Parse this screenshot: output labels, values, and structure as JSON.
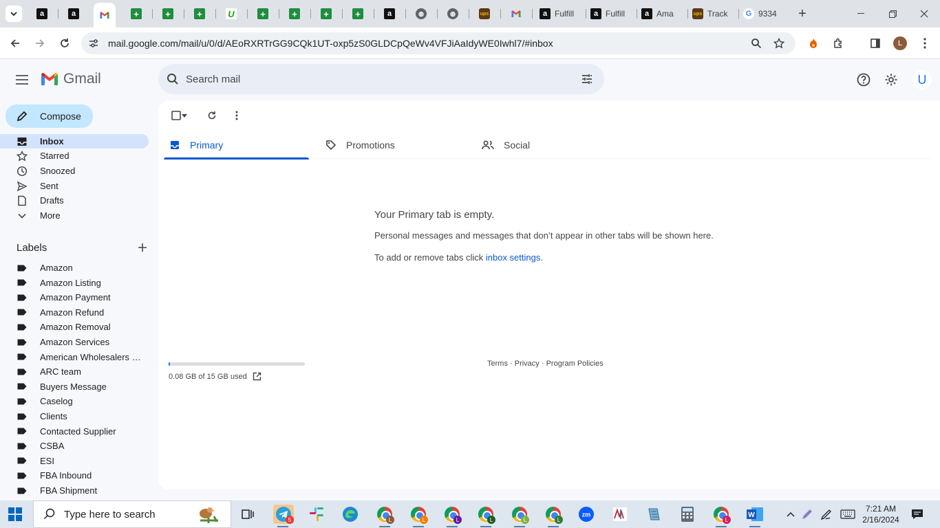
{
  "browser": {
    "tabs": [
      {
        "label": "",
        "favicon": "amazon"
      },
      {
        "label": "",
        "favicon": "amazon"
      },
      {
        "label": "",
        "favicon": "gmail",
        "active": true
      },
      {
        "label": "",
        "favicon": "sheets"
      },
      {
        "label": "",
        "favicon": "sheets"
      },
      {
        "label": "",
        "favicon": "sheets"
      },
      {
        "label": "",
        "favicon": "upwork"
      },
      {
        "label": "",
        "favicon": "sheets"
      },
      {
        "label": "",
        "favicon": "sheets"
      },
      {
        "label": "",
        "favicon": "sheets"
      },
      {
        "label": "",
        "favicon": "sheets"
      },
      {
        "label": "",
        "favicon": "amazon"
      },
      {
        "label": "",
        "favicon": "globe"
      },
      {
        "label": "",
        "favicon": "globe"
      },
      {
        "label": "",
        "favicon": "ups"
      },
      {
        "label": "",
        "favicon": "gmail"
      },
      {
        "label": "Fulfill",
        "favicon": "amazon"
      },
      {
        "label": "Fulfill",
        "favicon": "amazon"
      },
      {
        "label": "Ama",
        "favicon": "amazon"
      },
      {
        "label": "Track",
        "favicon": "ups"
      },
      {
        "label": "9334",
        "favicon": "google"
      }
    ],
    "url": "mail.google.com/mail/u/0/d/AEoRXRTrGG9CQk1UT-oxp5zS0GLDCpQeWv4VFJiAaIdyWE0Iwhl7/#inbox",
    "profile_initial": "L"
  },
  "gmail": {
    "app_name": "Gmail",
    "search_placeholder": "Search mail",
    "account_initial": "U",
    "compose_label": "Compose",
    "nav": [
      {
        "label": "Inbox",
        "icon": "inbox-icon",
        "selected": true
      },
      {
        "label": "Starred",
        "icon": "star-icon"
      },
      {
        "label": "Snoozed",
        "icon": "clock-icon"
      },
      {
        "label": "Sent",
        "icon": "send-icon"
      },
      {
        "label": "Drafts",
        "icon": "draft-icon"
      },
      {
        "label": "More",
        "icon": "chevron-down-icon"
      }
    ],
    "labels_heading": "Labels",
    "labels": [
      "Amazon",
      "Amazon Listing",
      "Amazon Payment",
      "Amazon Refund",
      "Amazon Removal",
      "Amazon Services",
      "American Wholesalers L...",
      "ARC team",
      "Buyers Message",
      "Caselog",
      "Clients",
      "Contacted Supplier",
      "CSBA",
      "ESI",
      "FBA Inbound",
      "FBA Shipment"
    ],
    "tabs": [
      {
        "label": "Primary",
        "icon": "inbox-icon",
        "active": true
      },
      {
        "label": "Promotions",
        "icon": "tag-icon"
      },
      {
        "label": "Social",
        "icon": "people-icon"
      }
    ],
    "empty": {
      "title": "Your Primary tab is empty.",
      "line1": "Personal messages and messages that don’t appear in other tabs will be shown here.",
      "line2_prefix": "To add or remove tabs click ",
      "line2_link": "inbox settings",
      "line2_suffix": "."
    },
    "storage": {
      "text": "0.08 GB of 15 GB used",
      "used_fraction": 0.005
    },
    "footer": {
      "terms": "Terms",
      "privacy": "Privacy",
      "policies": "Program Policies",
      "sep": " · "
    }
  },
  "taskbar": {
    "search_placeholder": "Type here to search",
    "time": "7:21 AM",
    "date": "2/16/2024",
    "telegram_badge": "5",
    "chrome_profiles": [
      "L",
      "L",
      "L",
      "L",
      "L",
      "L",
      "L"
    ]
  },
  "colors": {
    "accent": "#0b57d0",
    "compose_bg": "#c2e7ff",
    "selected_nav": "#d3e3fd",
    "page_bg": "#f6f8fc"
  }
}
